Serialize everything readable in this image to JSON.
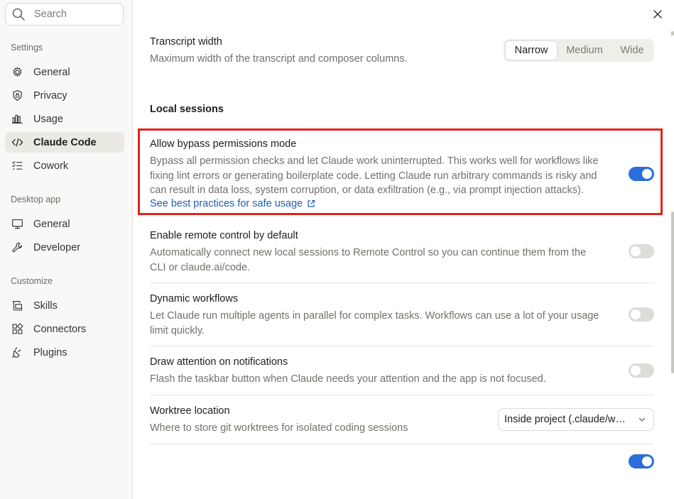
{
  "search": {
    "placeholder": "Search"
  },
  "sidebar": {
    "sections": [
      {
        "label": "Settings",
        "items": [
          {
            "label": "General",
            "icon": "gear-icon"
          },
          {
            "label": "Privacy",
            "icon": "shield-icon"
          },
          {
            "label": "Usage",
            "icon": "bar-chart-icon"
          },
          {
            "label": "Claude Code",
            "icon": "code-icon",
            "active": true
          },
          {
            "label": "Cowork",
            "icon": "checklist-icon"
          }
        ]
      },
      {
        "label": "Desktop app",
        "items": [
          {
            "label": "General",
            "icon": "monitor-icon"
          },
          {
            "label": "Developer",
            "icon": "wrench-icon"
          }
        ]
      },
      {
        "label": "Customize",
        "items": [
          {
            "label": "Skills",
            "icon": "skills-icon"
          },
          {
            "label": "Connectors",
            "icon": "connectors-icon"
          },
          {
            "label": "Plugins",
            "icon": "plug-icon"
          }
        ]
      }
    ]
  },
  "main": {
    "transcript": {
      "title": "Transcript width",
      "desc": "Maximum width of the transcript and composer columns.",
      "options": [
        "Narrow",
        "Medium",
        "Wide"
      ],
      "selected": "Narrow"
    },
    "local_sessions_heading": "Local sessions",
    "bypass": {
      "title": "Allow bypass permissions mode",
      "desc_lines": [
        "Bypass all permission checks and let Claude work uninterrupted. This works well for workflows like",
        "fixing lint errors or generating boilerplate code. Letting Claude run arbitrary commands is risky and",
        "can result in data loss, system corruption, or data exfiltration (e.g., via prompt injection attacks)."
      ],
      "link": "See best practices for safe usage",
      "enabled": true
    },
    "remote": {
      "title": "Enable remote control by default",
      "desc_lines": [
        "Automatically connect new local sessions to Remote Control so you can continue them from the",
        "CLI or claude.ai/code."
      ],
      "enabled": false
    },
    "dynamic": {
      "title": "Dynamic workflows",
      "desc_lines": [
        "Let Claude run multiple agents in parallel for complex tasks. Workflows can use a lot of your usage",
        "limit quickly."
      ],
      "enabled": false
    },
    "attention": {
      "title": "Draw attention on notifications",
      "desc_lines": [
        "Flash the taskbar button when Claude needs your attention and the app is not focused."
      ],
      "enabled": false
    },
    "worktree": {
      "title": "Worktree location",
      "desc": "Where to store git worktrees for isolated coding sessions",
      "value": "Inside project (.claude/w…"
    },
    "last_toggle_enabled": true
  },
  "colors": {
    "accent": "#2b6ed9",
    "highlight_border": "#e5211d",
    "link": "#1d5eb8"
  }
}
